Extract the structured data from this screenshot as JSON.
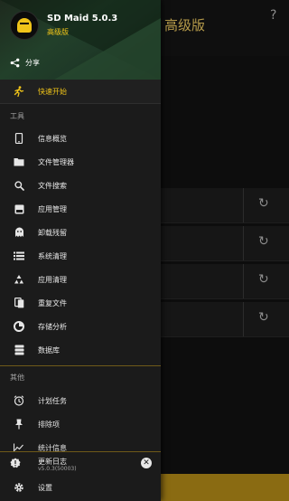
{
  "background": {
    "title": "高级版",
    "help": "?",
    "refresh_glyph": "↻",
    "cards": [
      {
        "refresh": "↻"
      },
      {
        "refresh": "↻"
      },
      {
        "refresh": "↻"
      },
      {
        "refresh": "↻"
      }
    ]
  },
  "drawer": {
    "app_name": "SD Maid 5.0.3",
    "edition": "高级版",
    "share_label": "分享",
    "quickstart_label": "快速开始",
    "tools_section": "工具",
    "tools": [
      {
        "label": "信息概览",
        "icon": "phone-icon"
      },
      {
        "label": "文件管理器",
        "icon": "folder-icon"
      },
      {
        "label": "文件搜索",
        "icon": "search-icon"
      },
      {
        "label": "应用管理",
        "icon": "app-box-icon"
      },
      {
        "label": "卸载残留",
        "icon": "ghost-icon"
      },
      {
        "label": "系统清理",
        "icon": "list-icon"
      },
      {
        "label": "应用清理",
        "icon": "recycle-icon"
      },
      {
        "label": "重复文件",
        "icon": "duplicate-icon"
      },
      {
        "label": "存储分析",
        "icon": "pie-chart-icon"
      },
      {
        "label": "数据库",
        "icon": "database-icon"
      }
    ],
    "other_section": "其他",
    "others": [
      {
        "label": "计划任务",
        "icon": "alarm-icon"
      },
      {
        "label": "排除项",
        "icon": "pin-icon"
      },
      {
        "label": "统计信息",
        "icon": "stats-icon"
      }
    ],
    "news": {
      "title": "更新日志",
      "version": "v5.0.3(50003)",
      "close": "✕"
    },
    "settings_label": "设置"
  },
  "colors": {
    "accent": "#f0c419",
    "drawer_bg": "#1b1b1b",
    "bottom_bar": "#8a6b12"
  }
}
